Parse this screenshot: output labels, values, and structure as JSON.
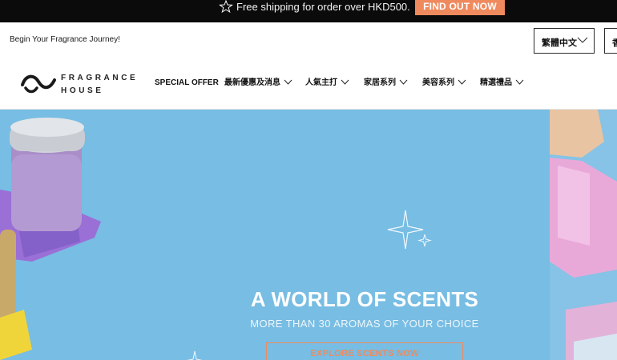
{
  "announcement": {
    "message": "Free shipping for order over HKD500.",
    "cta_label": "FIND OUT NOW",
    "star_icon": "star-outline-icon",
    "cta_color": "#ef8a5e"
  },
  "header": {
    "tagline": "Begin Your Fragrance Journey!",
    "language_selected": "繁體中文",
    "language_second": "香",
    "logo": {
      "line1": "FRAGRANCE",
      "line2": "HOUSE"
    }
  },
  "nav": {
    "items": [
      {
        "label": "SPECIAL OFFER",
        "has_dropdown": false
      },
      {
        "label": "最新優惠及消息",
        "has_dropdown": true
      },
      {
        "label": "人氣主打",
        "has_dropdown": true
      },
      {
        "label": "家居系列",
        "has_dropdown": true
      },
      {
        "label": "美容系列",
        "has_dropdown": true
      },
      {
        "label": "精選禮品",
        "has_dropdown": true
      }
    ]
  },
  "hero": {
    "title": "A WORLD OF SCENTS",
    "subtitle": "MORE THAN 30 AROMAS OF YOUR CHOICE",
    "button_label": "EXPLORE SCENTS NOW",
    "background_color": "#78bde3",
    "accent_color": "#ef8a5e"
  }
}
